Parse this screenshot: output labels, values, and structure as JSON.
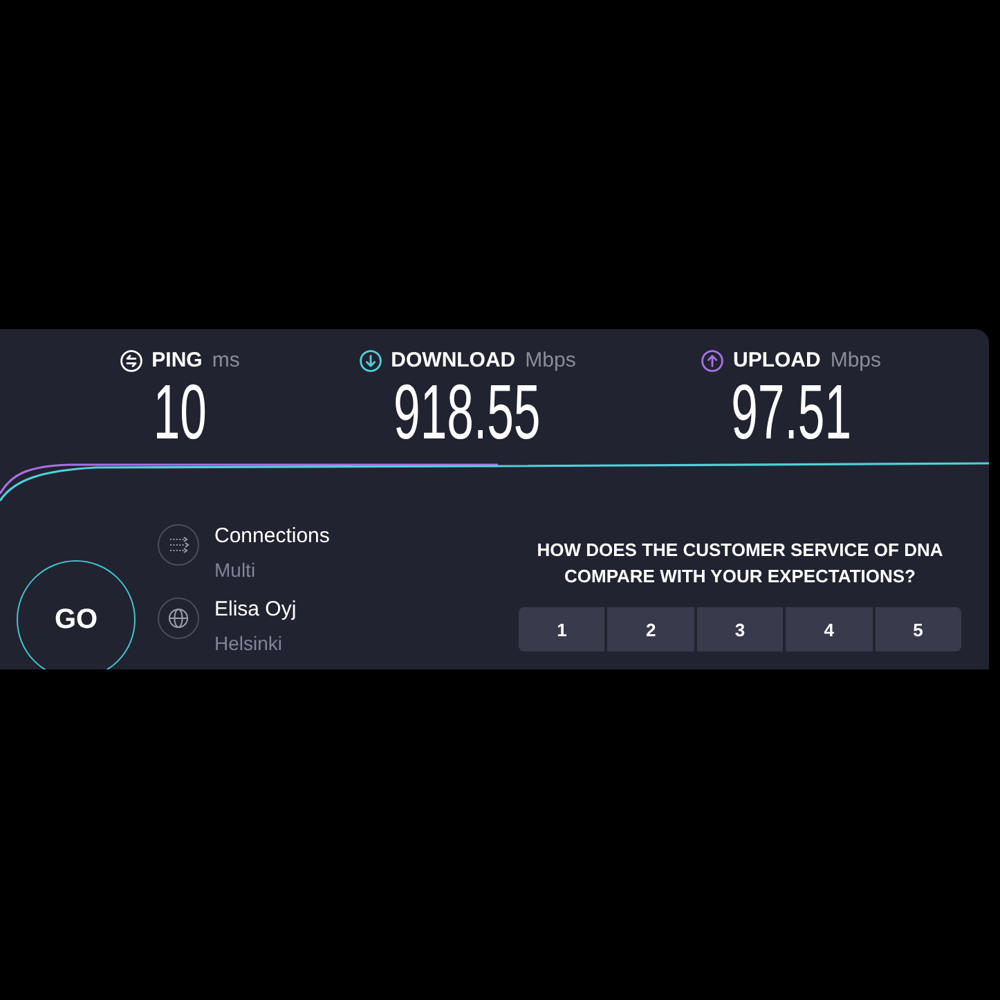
{
  "metrics": [
    {
      "kind": "ping",
      "label": "PING",
      "unit": "ms",
      "value": "10",
      "color": "#ffffff"
    },
    {
      "kind": "download",
      "label": "DOWNLOAD",
      "unit": "Mbps",
      "value": "918.55",
      "color": "#4fd1d9"
    },
    {
      "kind": "upload",
      "label": "UPLOAD",
      "unit": "Mbps",
      "value": "97.51",
      "color": "#a970e8"
    }
  ],
  "go_button": {
    "label": "GO"
  },
  "test_details": [
    {
      "kind": "connections",
      "title": "Connections",
      "subtitle": "Multi"
    },
    {
      "kind": "server",
      "title": "Elisa Oyj",
      "subtitle": "Helsinki"
    }
  ],
  "survey": {
    "question": "HOW DOES THE CUSTOMER SERVICE OF DNA COMPARE WITH YOUR EXPECTATIONS?",
    "options": [
      {
        "label": "1",
        "selected": false
      },
      {
        "label": "2",
        "selected": false
      },
      {
        "label": "3",
        "selected": false
      },
      {
        "label": "4",
        "selected": false
      },
      {
        "label": "5",
        "selected": false
      }
    ]
  }
}
